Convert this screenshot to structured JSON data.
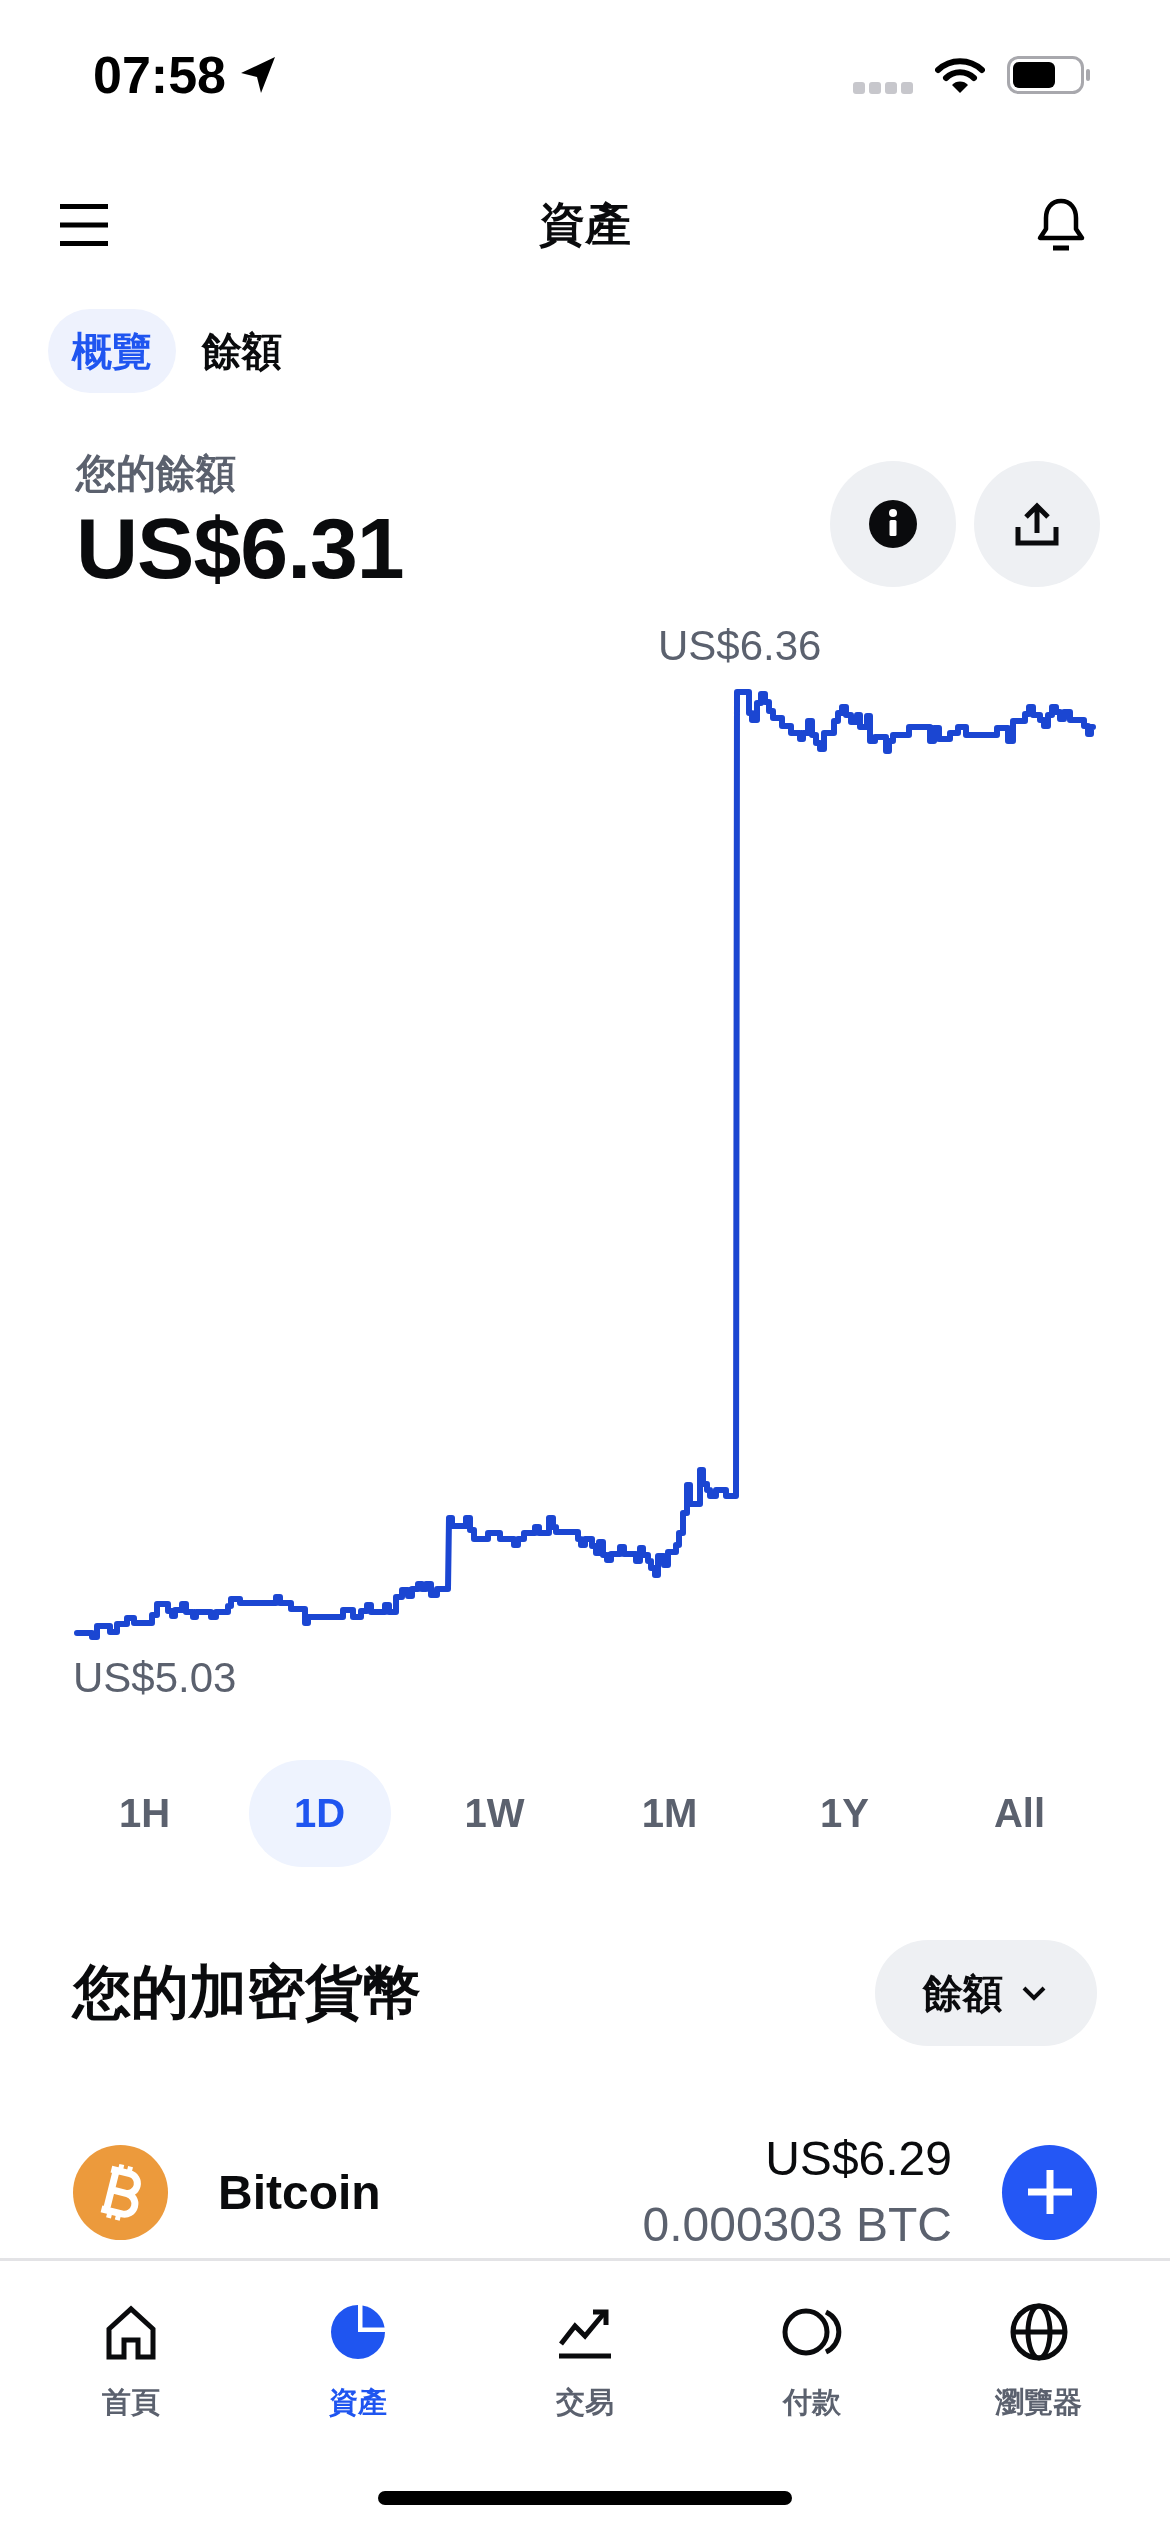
{
  "status_bar": {
    "time": "07:58"
  },
  "header": {
    "title": "資產"
  },
  "tabs": [
    {
      "label": "概覽",
      "selected": true
    },
    {
      "label": "餘額",
      "selected": false
    }
  ],
  "balance": {
    "label": "您的餘額",
    "amount": "US$6.31"
  },
  "chart": {
    "high_label": "US$6.36",
    "low_label": "US$5.03"
  },
  "ranges": [
    {
      "label": "1H",
      "selected": false
    },
    {
      "label": "1D",
      "selected": true
    },
    {
      "label": "1W",
      "selected": false
    },
    {
      "label": "1M",
      "selected": false
    },
    {
      "label": "1Y",
      "selected": false
    },
    {
      "label": "All",
      "selected": false
    }
  ],
  "crypto": {
    "title": "您的加密貨幣",
    "sort_button": "餘額",
    "assets": [
      {
        "name": "Bitcoin",
        "value": "US$6.29",
        "amount": "0.000303 BTC"
      }
    ]
  },
  "nav": [
    {
      "label": "首頁",
      "selected": false
    },
    {
      "label": "資產",
      "selected": true
    },
    {
      "label": "交易",
      "selected": false
    },
    {
      "label": "付款",
      "selected": false
    },
    {
      "label": "瀏覽器",
      "selected": false
    }
  ]
}
